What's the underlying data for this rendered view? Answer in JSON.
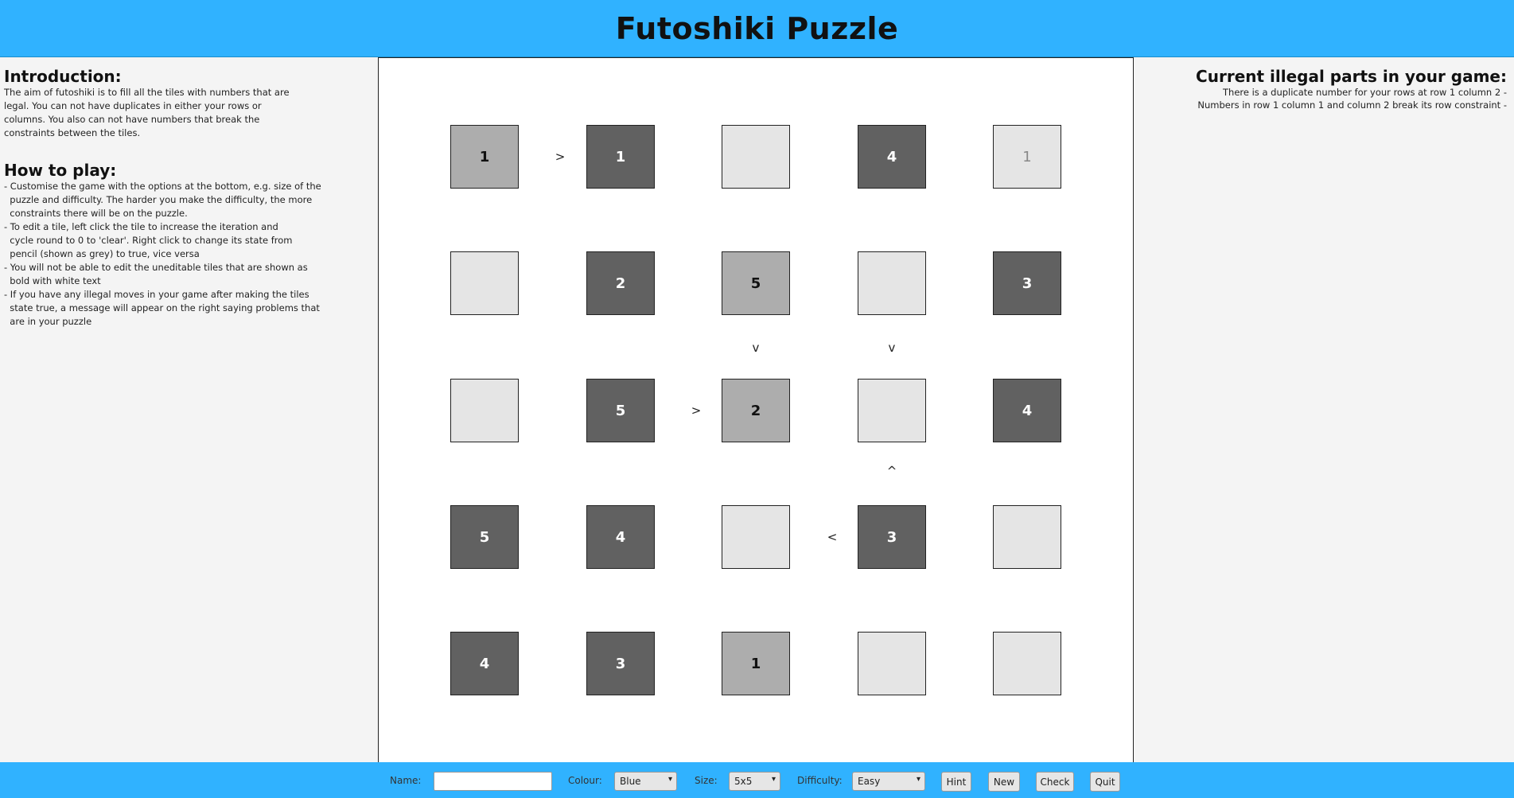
{
  "header": {
    "title": "Futoshiki Puzzle"
  },
  "intro": {
    "heading": "Introduction:",
    "text": "The aim of futoshiki is to fill all the tiles with numbers that are legal. You can not have duplicates in either your rows or columns. You also can not have numbers that break the constraints between the tiles."
  },
  "howto": {
    "heading": "How to play:",
    "lines": [
      "- Customise the game with the options at the bottom, e.g. size of the",
      "  puzzle and difficulty. The harder you make the difficulty, the more",
      "  constraints there will be on the puzzle.",
      "- To edit a tile, left click the tile to increase the iteration and",
      "  cycle round to 0 to 'clear'. Right click to change its state from",
      "  pencil (shown as grey) to true, vice versa",
      "- You will not be able to edit the uneditable tiles that are shown as",
      "  bold with white text",
      "- If you have any illegal moves in your game after making the tiles",
      "  state true, a message will appear on the right saying problems that",
      "  are in your puzzle"
    ]
  },
  "board": {
    "rows": [
      [
        {
          "value": "1",
          "state": "true"
        },
        {
          "value": "1",
          "state": "fixed"
        },
        {
          "value": "",
          "state": "empty"
        },
        {
          "value": "4",
          "state": "fixed"
        },
        {
          "value": "1",
          "state": "pencil"
        }
      ],
      [
        {
          "value": "",
          "state": "empty"
        },
        {
          "value": "2",
          "state": "fixed"
        },
        {
          "value": "5",
          "state": "true"
        },
        {
          "value": "",
          "state": "empty"
        },
        {
          "value": "3",
          "state": "fixed"
        }
      ],
      [
        {
          "value": "",
          "state": "empty"
        },
        {
          "value": "5",
          "state": "fixed"
        },
        {
          "value": "2",
          "state": "true"
        },
        {
          "value": "",
          "state": "empty"
        },
        {
          "value": "4",
          "state": "fixed"
        }
      ],
      [
        {
          "value": "5",
          "state": "fixed"
        },
        {
          "value": "4",
          "state": "fixed"
        },
        {
          "value": "",
          "state": "empty"
        },
        {
          "value": "3",
          "state": "fixed"
        },
        {
          "value": "",
          "state": "empty"
        }
      ],
      [
        {
          "value": "4",
          "state": "fixed"
        },
        {
          "value": "3",
          "state": "fixed"
        },
        {
          "value": "1",
          "state": "true"
        },
        {
          "value": "",
          "state": "empty"
        },
        {
          "value": "",
          "state": "empty"
        }
      ]
    ],
    "constraints": {
      "r1_c1_c2": ">",
      "r3_c2_c3": ">",
      "r4_c3_c4": "<",
      "c3_r2_r3": "v",
      "c4_r2_r3": "v",
      "c4_r3_r4": "^"
    }
  },
  "illegal": {
    "heading": "Current illegal parts in your game:",
    "lines": [
      "There is a duplicate number for your rows at row 1 column 2 -",
      "Numbers in row 1 column 1 and column 2 break its row constraint -"
    ]
  },
  "footer": {
    "name_label": "Name:",
    "name_value": "",
    "colour_label": "Colour:",
    "colour_value": "Blue",
    "size_label": "Size:",
    "size_value": "5x5",
    "difficulty_label": "Difficulty:",
    "difficulty_value": "Easy",
    "hint": "Hint",
    "new": "New",
    "check": "Check",
    "quit": "Quit"
  },
  "icons": {
    "dropdown": "chevron-down-icon"
  }
}
